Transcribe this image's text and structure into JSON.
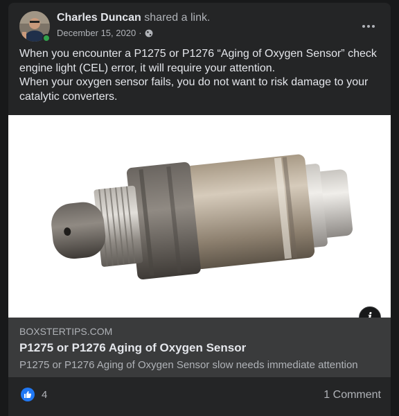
{
  "post": {
    "author": "Charles Duncan",
    "action": "shared a link.",
    "date": "December 15, 2020",
    "separator": "·",
    "audience_icon": "globe-icon",
    "menu_icon": "more-options-icon",
    "text_lines": [
      "When you encounter a P1275 or P1276 “Aging of Oxygen Sensor” check engine light (CEL) error, it will require your attention.",
      "When your oxygen sensor fails, you do not want to risk damage to your catalytic converters."
    ]
  },
  "link": {
    "image_icon": "oxygen-sensor-photo",
    "info_label": "i",
    "domain": "BOXSTERTIPS.COM",
    "title": "P1275 or P1276 Aging of Oxygen Sensor",
    "description": "P1275 or P1276 Aging of Oxygen Sensor slow needs immediate attention"
  },
  "reactions": {
    "like_icon": "thumbs-up-icon",
    "like_count": "4",
    "comments": "1 Comment"
  },
  "colors": {
    "background": "#18191a",
    "card": "#242526",
    "preview": "#3a3b3c",
    "primary_text": "#e4e6eb",
    "secondary_text": "#b0b3b8",
    "like_blue": "#2078f4",
    "online_green": "#31a24c"
  }
}
